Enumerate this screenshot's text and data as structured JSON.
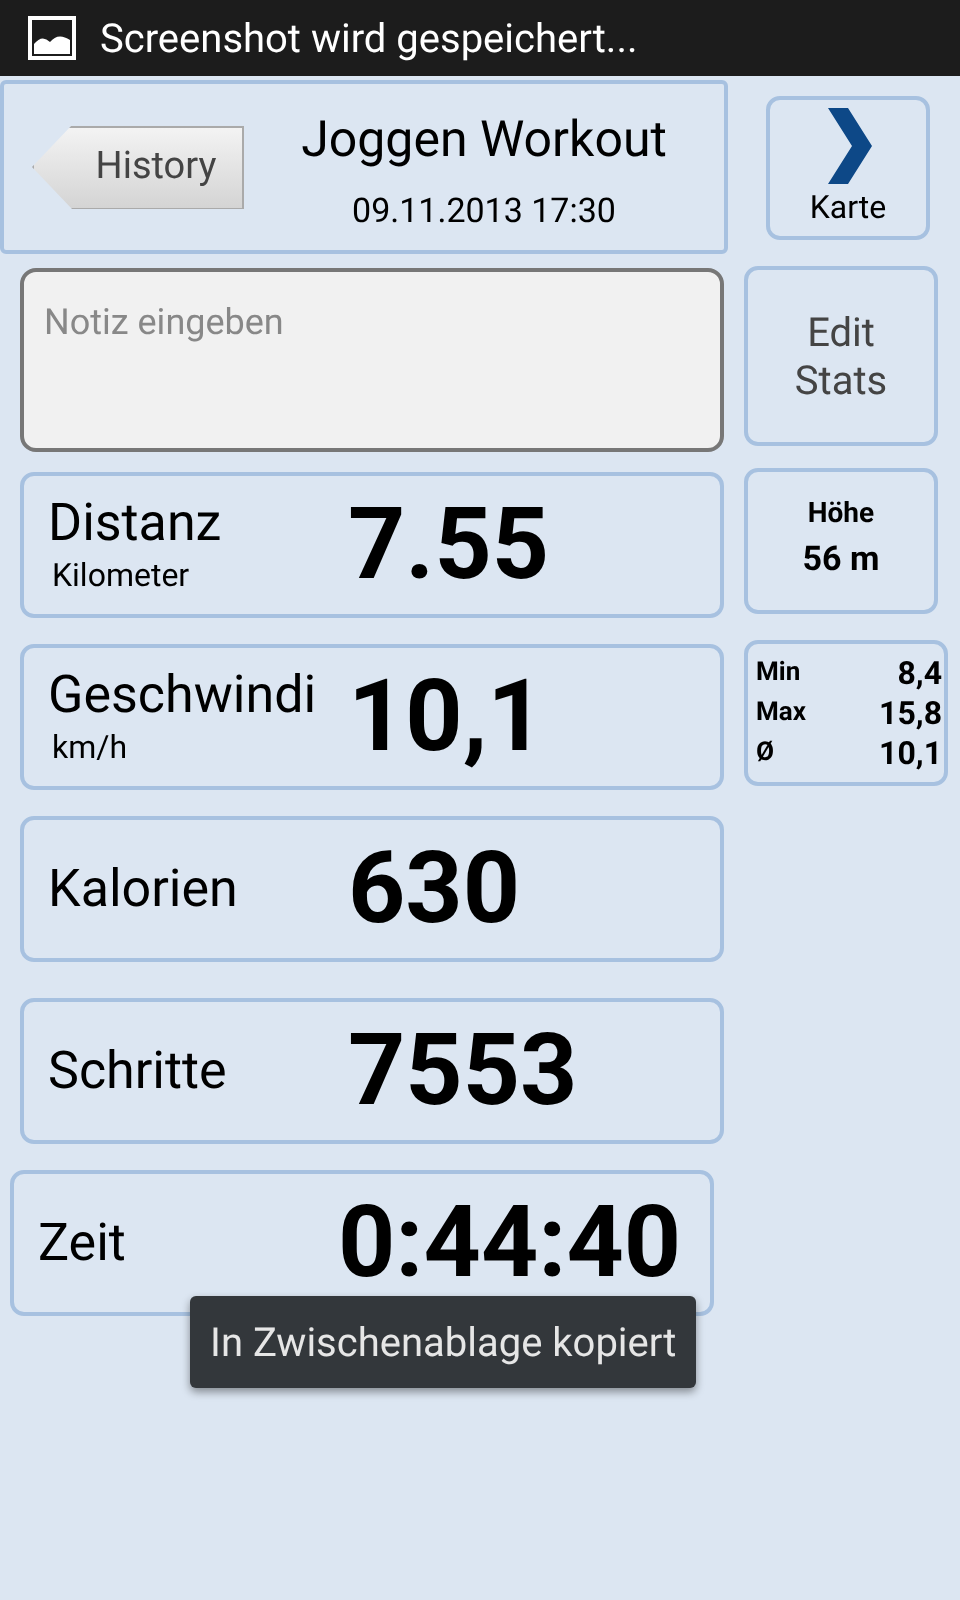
{
  "status_bar": {
    "notification": "Screenshot wird gespeichert..."
  },
  "header": {
    "back_button": "History",
    "title": "Joggen Workout",
    "date": "09.11.2013 17:30"
  },
  "map_button": {
    "label": "Karte"
  },
  "note": {
    "placeholder": "Notiz eingeben"
  },
  "edit_button": {
    "label": "Edit Stats"
  },
  "stats": [
    {
      "label": "Distanz",
      "unit": "Kilometer",
      "value": "7.55"
    },
    {
      "label": "Geschwindi",
      "unit": "km/h",
      "value": "10,1"
    },
    {
      "label": "Kalorien",
      "value": "630"
    },
    {
      "label": "Schritte",
      "value": "7553"
    },
    {
      "label": "Zeit",
      "value": "0:44:40"
    }
  ],
  "altitude": {
    "label": "Höhe",
    "value": "56 m"
  },
  "speed_summary": [
    {
      "label": "Min",
      "value": "8,4"
    },
    {
      "label": "Max",
      "value": "15,8"
    },
    {
      "label": "Ø",
      "value": "10,1"
    }
  ],
  "toast": "In Zwischenablage kopiert"
}
